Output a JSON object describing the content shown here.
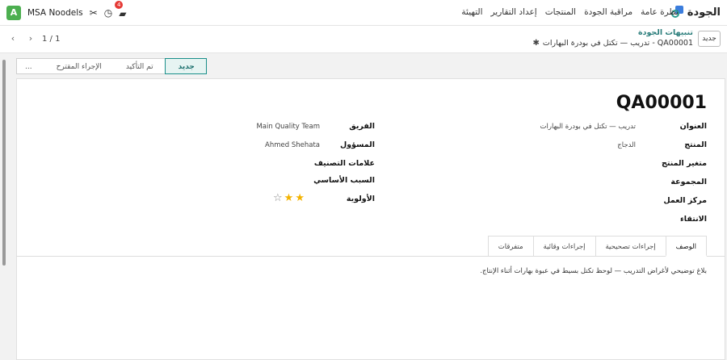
{
  "topbar": {
    "app_name": "الجودة",
    "menu": [
      "نظرة عامة",
      "مراقبة الجودة",
      "المنتجات",
      "إعداد التقارير",
      "التهيئة"
    ],
    "avatar_letter": "A",
    "company": "MSA Noodels",
    "chat_badge": "4"
  },
  "control": {
    "new_button": "جديد",
    "breadcrumb_parent": "تنبيهات الجودة",
    "breadcrumb_current": "QA00001 - تدريب — تكتل في بودرة البهارات",
    "pager": "1 / 1"
  },
  "status": {
    "stages": [
      "جديد",
      "تم التأكيد",
      "الإجراء المقترح",
      "..."
    ],
    "active_index": 0
  },
  "record": {
    "title": "QA00001",
    "left_fields": [
      {
        "label": "العنوان",
        "value": "تدريب — تكتل في بودرة البهارات"
      },
      {
        "label": "المنتج",
        "value": "الدجاج"
      },
      {
        "label": "متغير المنتج",
        "value": ""
      },
      {
        "label": "المجموعة",
        "value": ""
      },
      {
        "label": "مركز العمل",
        "value": ""
      },
      {
        "label": "الانتقاء",
        "value": ""
      }
    ],
    "right_fields": [
      {
        "label": "الفريق",
        "value": "Main Quality Team"
      },
      {
        "label": "المسؤول",
        "value": "Ahmed Shehata"
      },
      {
        "label": "علامات التصنيف",
        "value": ""
      },
      {
        "label": "السبب الأساسي",
        "value": ""
      },
      {
        "label": "الأولوية",
        "value": ""
      }
    ],
    "priority_stars": 2,
    "priority_max": 3
  },
  "tabs": [
    "الوصف",
    "إجراءات تصحيحية",
    "إجراءات وقائية",
    "متفرقات"
  ],
  "description": "بلاغ توضيحي لأغراض التدريب — لوحظ تكتل بسيط في عبوة بهارات أثناء الإنتاج."
}
